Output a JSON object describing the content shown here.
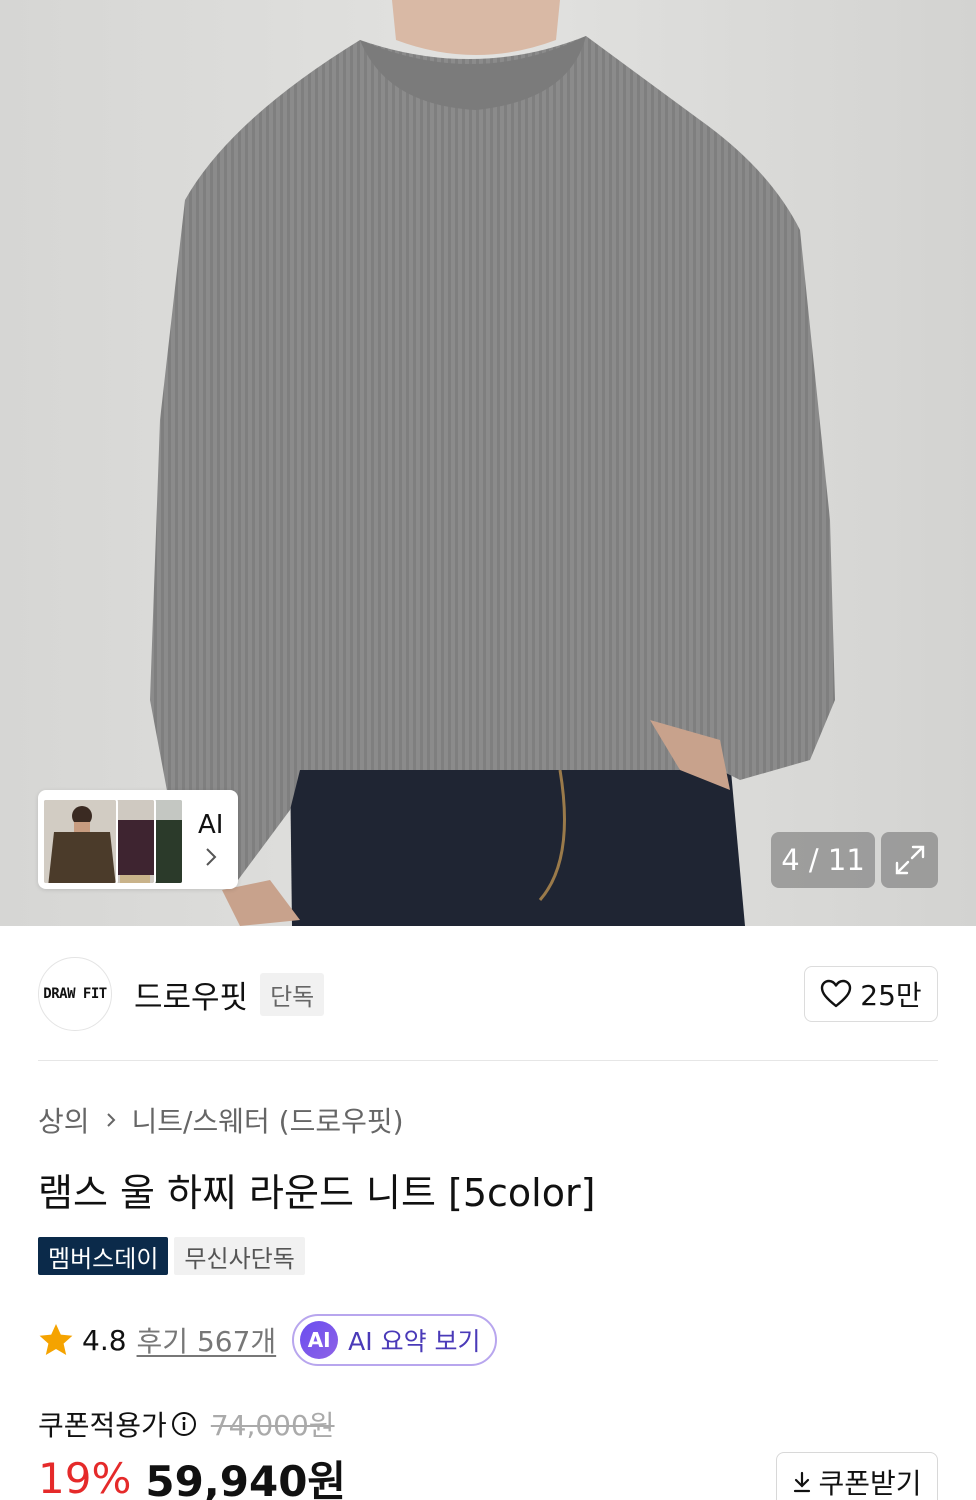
{
  "gallery": {
    "counter": "4 / 11",
    "ai_looks_label": "AI"
  },
  "brand": {
    "logo_text": "DRAW FIT",
    "name": "드로우핏",
    "tag": "단독",
    "likes": "25만"
  },
  "breadcrumb": {
    "category": "상의",
    "subcategory": "니트/스웨터 (드로우핏)"
  },
  "product": {
    "title": "램스 울 하찌 라운드 니트 [5color]",
    "badges": [
      "멤버스데이",
      "무신사단독"
    ]
  },
  "review": {
    "rating": "4.8",
    "review_count": "후기 567개",
    "ai_summary_icon": "AI",
    "ai_summary_label": "AI 요약 보기"
  },
  "price": {
    "coupon_label": "쿠폰적용가",
    "original": "74,000원",
    "discount": "19%",
    "final": "59,940원",
    "coupon_button": "쿠폰받기"
  },
  "colors": {
    "discount_red": "#e52a2a",
    "member_badge_bg": "#0b2a4a",
    "star": "#f5a300",
    "ai_purple": "#6a4df0"
  }
}
